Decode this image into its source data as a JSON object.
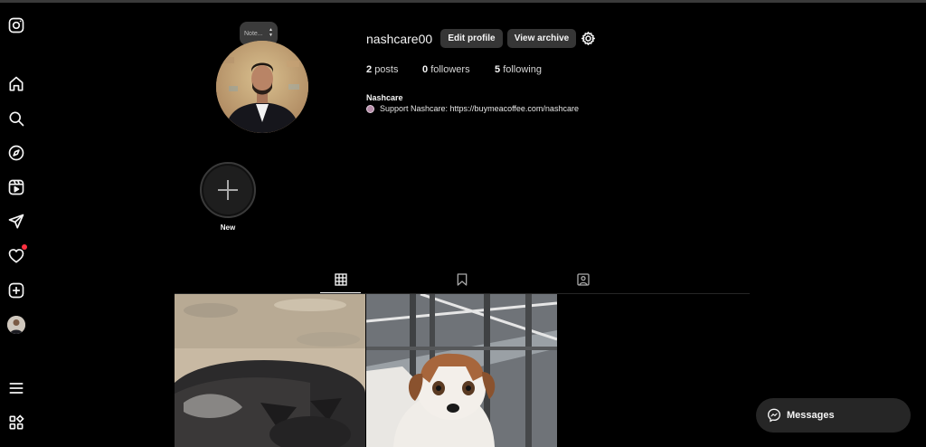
{
  "sidebar": {
    "items": [
      {
        "icon": "instagram-icon"
      },
      {
        "icon": "home-icon"
      },
      {
        "icon": "search-icon"
      },
      {
        "icon": "explore-icon"
      },
      {
        "icon": "reels-icon"
      },
      {
        "icon": "messages-icon"
      },
      {
        "icon": "notifications-icon"
      },
      {
        "icon": "create-icon"
      },
      {
        "icon": "profile-icon"
      },
      {
        "icon": "menu-icon"
      },
      {
        "icon": "more-apps-icon"
      }
    ]
  },
  "profile": {
    "note_placeholder": "Note...",
    "username": "nashcare00",
    "edit_profile_label": "Edit profile",
    "view_archive_label": "View archive",
    "stats": {
      "posts_count": "2",
      "posts_label": "posts",
      "followers_count": "0",
      "followers_label": "followers",
      "following_count": "5",
      "following_label": "following"
    },
    "bio_name": "Nashcare",
    "bio_text": "Support Nashcare: https://buymeacoffee.com/nashcare"
  },
  "highlights": {
    "new_label": "New"
  },
  "tabs": [
    {
      "icon": "grid-icon",
      "active": true
    },
    {
      "icon": "saved-icon",
      "active": false
    },
    {
      "icon": "tagged-icon",
      "active": false
    }
  ],
  "posts": [
    {
      "subject": "black dog lying on ground"
    },
    {
      "subject": "brown and white puppy near railing"
    }
  ],
  "messages": {
    "label": "Messages"
  },
  "colors": {
    "background": "#000000",
    "button": "#363636",
    "notification": "#ff3040"
  }
}
